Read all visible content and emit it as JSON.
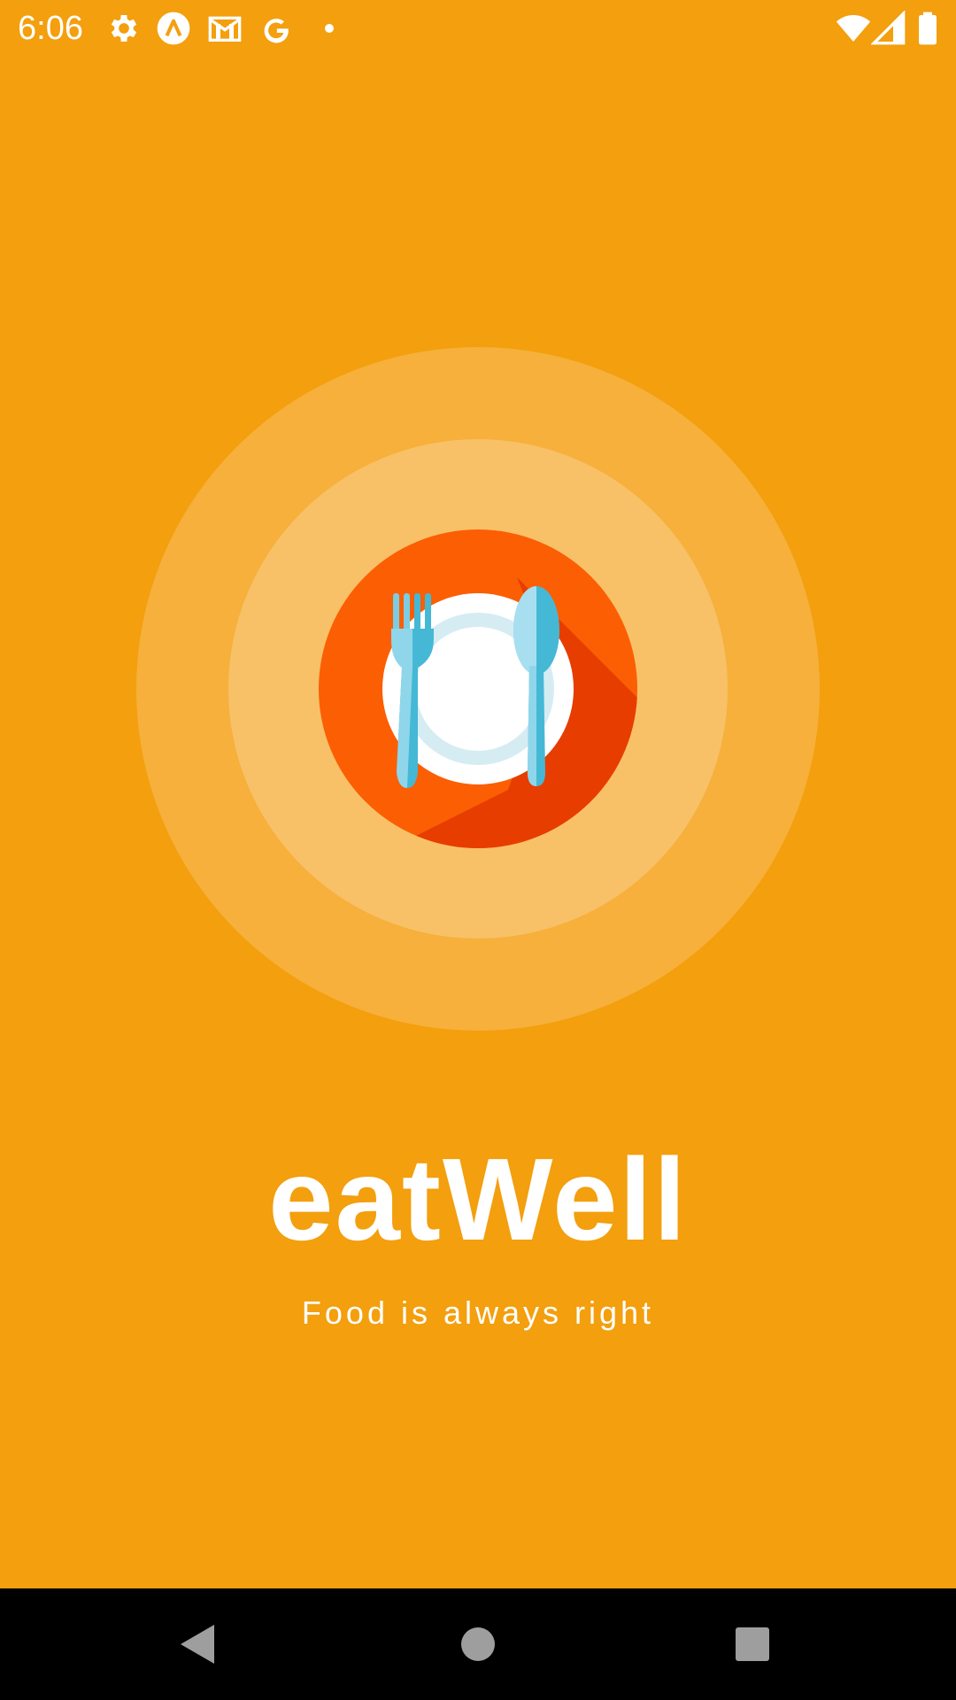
{
  "status_bar": {
    "time": "6:06",
    "left_icons": [
      "gear-icon",
      "a-circle-icon",
      "gmail-icon",
      "google-icon",
      "dot-icon"
    ],
    "right_icons": [
      "wifi-icon",
      "signal-icon",
      "battery-icon"
    ]
  },
  "splash": {
    "title": "eatWell",
    "tagline": "Food is always right",
    "logo_icon": "plate-fork-spoon-icon"
  },
  "colors": {
    "background": "#f39f0e",
    "ring_outer": "#f6b03b",
    "ring_inner": "#f8c167",
    "plate_circle": "#fc5e03",
    "plate_shadow": "#e73d00",
    "cutlery": "#45b8d6",
    "nav_bar": "#000000"
  },
  "nav_bar": {
    "buttons": [
      "back-button",
      "home-button",
      "recents-button"
    ]
  }
}
